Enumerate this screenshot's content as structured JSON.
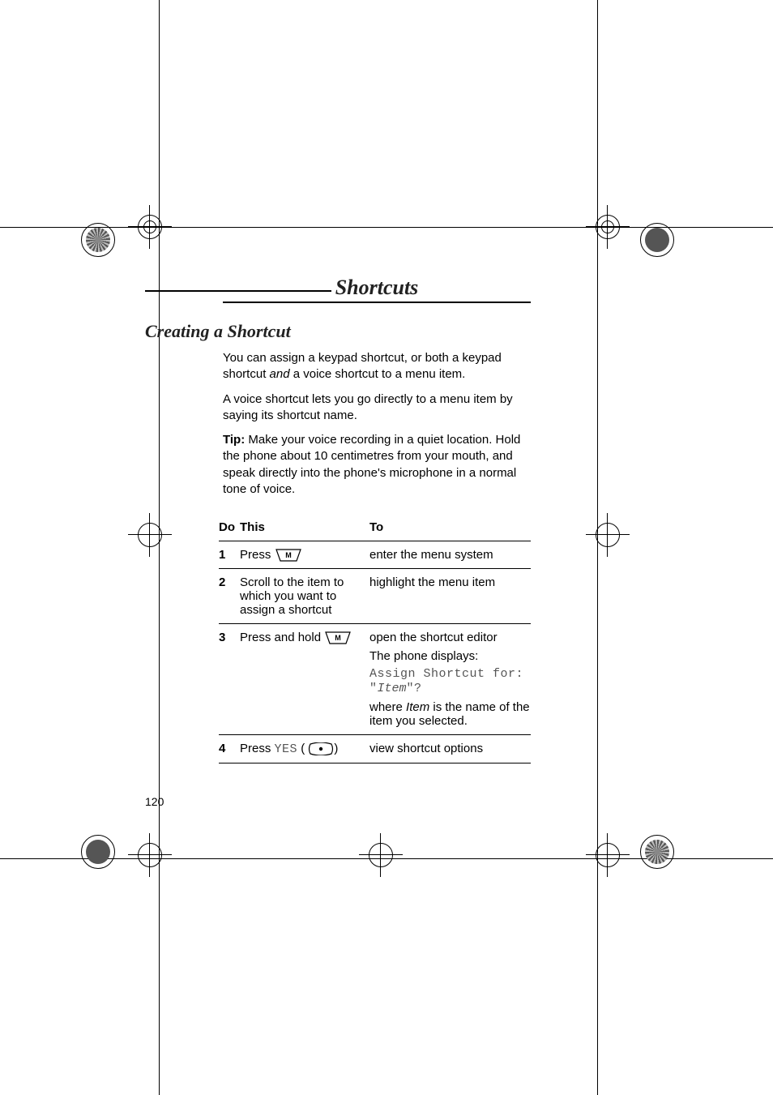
{
  "chapter_title": "Shortcuts",
  "section_title": "Creating a Shortcut",
  "paragraphs": {
    "p1a": "You can assign a keypad shortcut, or both a keypad shortcut ",
    "p1b": "and",
    "p1c": " a voice shortcut to a menu item.",
    "p2": "A voice shortcut lets you go directly to a menu item by saying its shortcut name.",
    "p3a": "Tip:",
    "p3b": " Make your voice recording in a quiet location. Hold the phone about 10 centimetres from your mouth, and speak directly into the phone's microphone in a normal tone of voice."
  },
  "table": {
    "headers": {
      "do": "Do",
      "this": "This",
      "to": "To"
    },
    "rows": [
      {
        "num": "1",
        "do_prefix": "Press ",
        "key": "M",
        "to": "enter the menu system"
      },
      {
        "num": "2",
        "do": "Scroll to the item to which you want to assign a shortcut",
        "to": "highlight the menu item"
      },
      {
        "num": "3",
        "do_prefix": "Press and hold ",
        "key": "M",
        "to_lines": {
          "l1": "open the shortcut editor",
          "l2": "The phone displays:",
          "l3a": "Assign Shortcut for: \"",
          "l3b": "Item",
          "l3c": "\"?",
          "l4a": "where ",
          "l4b": "Item",
          "l4c": " is the name of the item you selected."
        }
      },
      {
        "num": "4",
        "do_prefix": "Press ",
        "do_yes": "YES",
        "do_suffix": " (",
        "key": "plus",
        "do_close": ")",
        "to": "view shortcut options"
      }
    ]
  },
  "page_number": "120"
}
